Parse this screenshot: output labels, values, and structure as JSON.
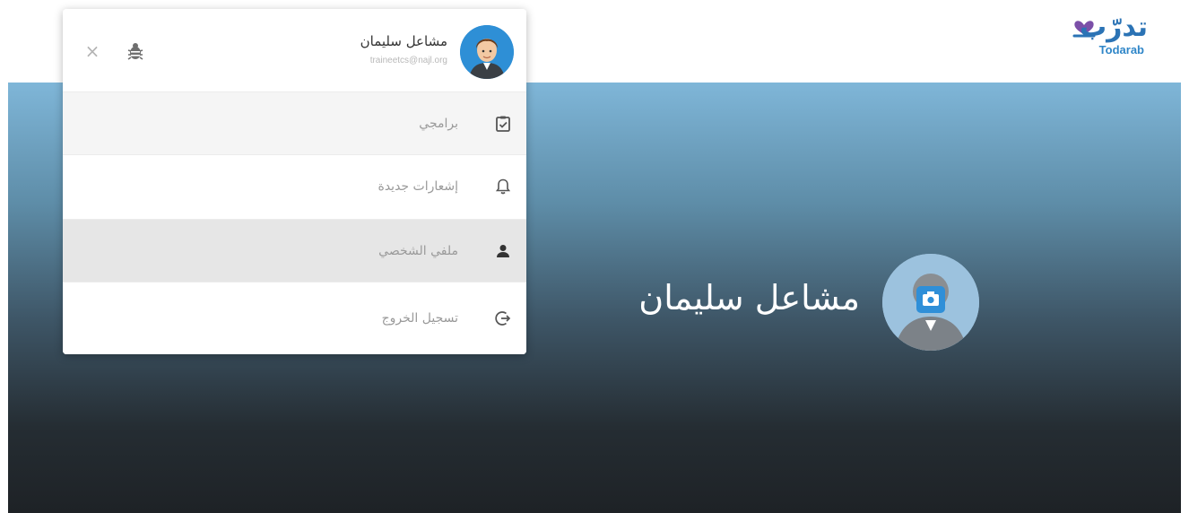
{
  "brand": {
    "logo_ar": "تدرّب",
    "logo_en": "Todarab"
  },
  "profile": {
    "name": "مشاعل سليمان"
  },
  "dropdown": {
    "user_name": "مشاعل سليمان",
    "user_email": "traineetcs@najl.org",
    "close_label": "×",
    "items": [
      {
        "label": "برامجي",
        "icon": "clipboard-check-icon"
      },
      {
        "label": "إشعارات جديدة",
        "icon": "bell-icon"
      },
      {
        "label": "ملفي الشخصي",
        "icon": "person-icon"
      },
      {
        "label": "تسجيل الخروج",
        "icon": "logout-icon"
      }
    ]
  },
  "colors": {
    "brand_blue": "#2b73b5",
    "hero_top": "#7fb6d8",
    "hero_bottom": "#1e2226",
    "active_row": "#e6e6e6"
  }
}
